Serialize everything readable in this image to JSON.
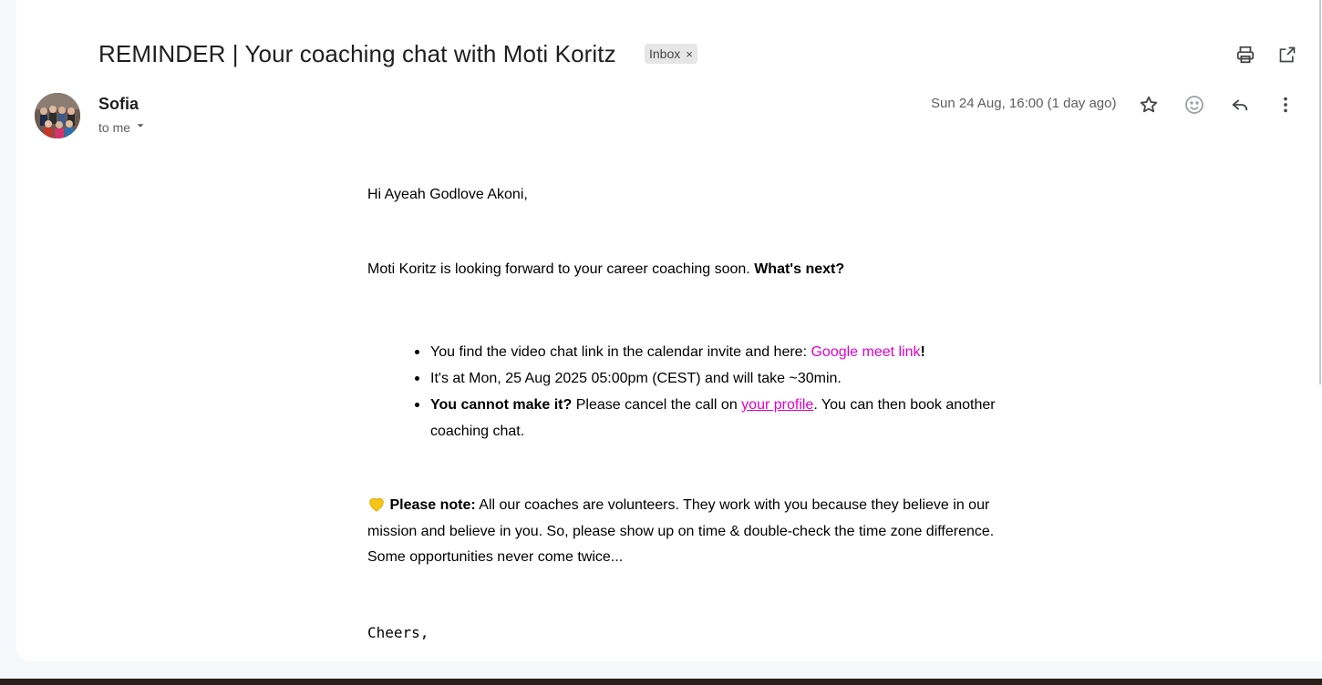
{
  "email": {
    "subject": "REMINDER | Your coaching chat with Moti Koritz",
    "label": "Inbox",
    "label_remove": "×",
    "sender": "Sofia",
    "recipient": "to me",
    "date": "Sun 24 Aug, 16:00 (1 day ago)"
  },
  "icons": {
    "print": "print-icon",
    "open_new_window": "open-in-new-window-icon",
    "star": "star-icon",
    "emoji": "emoji-reaction-icon",
    "reply": "reply-icon",
    "more": "more-vert-icon",
    "dropdown": "chevron-down-icon",
    "heart": "yellow-heart-icon"
  },
  "message": {
    "greeting": "Hi Ayeah Godlove Akoni,",
    "intro_text": "Moti Koritz is looking forward to your career coaching soon. ",
    "intro_bold": "What's next?",
    "bullet1_text": "You find the video chat link in the calendar invite and here: ",
    "bullet1_link": "Google meet link",
    "bullet1_end": "!",
    "bullet2_text": "It's at Mon, 25 Aug 2025 05:00pm (CEST) and will take ~30min.",
    "bullet3_bold": "You cannot make it?",
    "bullet3_text": " Please cancel the call on ",
    "bullet3_link": "your profile",
    "bullet3_end": ". You can then book another coaching chat.",
    "note_emoji": "💛",
    "note_bold": "Please note:",
    "note_text": " All our coaches are volunteers. They work with you because they believe in our mission and believe in you. So, please show up on time & double-check the time zone difference. Some opportunities never come twice...",
    "signoff": "Cheers,"
  },
  "colors": {
    "link": "#e000d0",
    "background": "#f6f8fc",
    "card": "#ffffff"
  }
}
